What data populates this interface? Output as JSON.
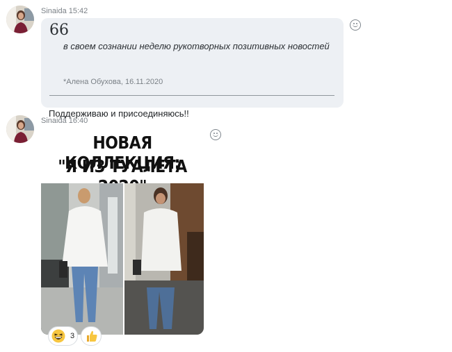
{
  "messages": [
    {
      "sender": "Sinaida",
      "time": "15:42",
      "quote": {
        "text": "в своем сознании неделю рукотворных позитивных новостей",
        "author": "*Алена Обухова, 16.11.2020"
      },
      "text": "Поддерживаю и присоединяюсь!!"
    },
    {
      "sender": "Sinaida",
      "time": "16:40",
      "image": {
        "title_line1": "НОВАЯ КОЛЛЕКЦИЯ:",
        "title_line2": "\"Я ИЗ ТУАЛЕТА 2020\""
      },
      "reactions": [
        {
          "icon": "laughing-face-icon",
          "count": "3"
        },
        {
          "icon": "thumbs-up-icon",
          "count": ""
        }
      ]
    }
  ],
  "colors": {
    "bubble": "#edf0f4",
    "meta_text": "#7a8086",
    "reaction_yellow": "#f7c640"
  }
}
